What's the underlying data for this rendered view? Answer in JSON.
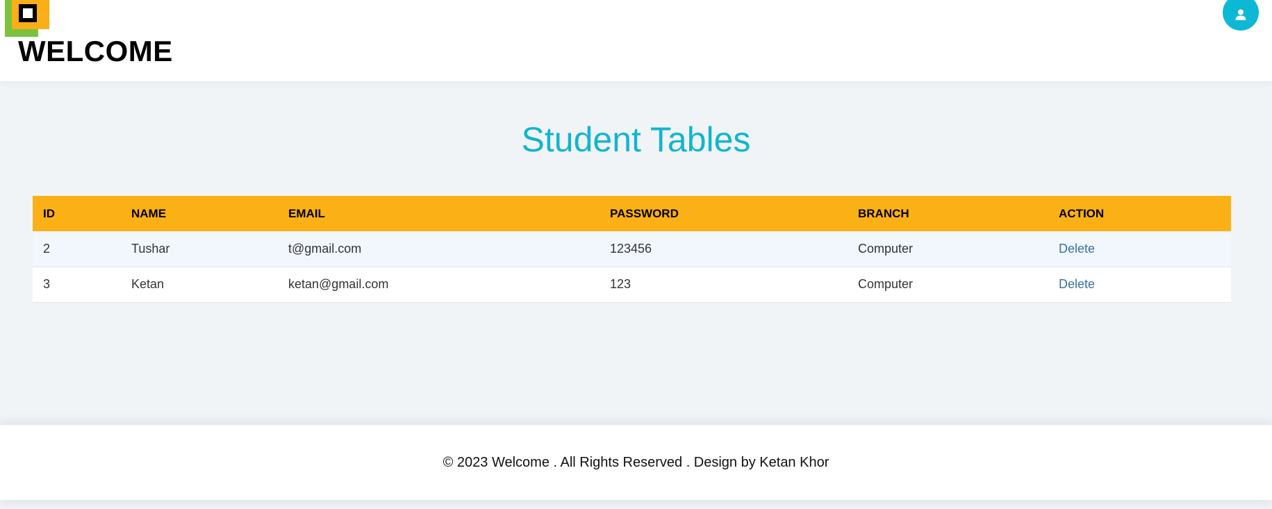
{
  "header": {
    "brand": "WELCOME",
    "logo_colors": [
      "#7cc23f",
      "#fbae17",
      "#000000"
    ],
    "user_icon": "user-icon"
  },
  "main": {
    "title": "Student Tables",
    "table": {
      "columns": [
        "ID",
        "NAME",
        "EMAIL",
        "PASSWORD",
        "BRANCH",
        "ACTION"
      ],
      "rows": [
        {
          "id": "2",
          "name": "Tushar",
          "email": "t@gmail.com",
          "password": "123456",
          "branch": "Computer",
          "action": "Delete"
        },
        {
          "id": "3",
          "name": "Ketan",
          "email": "ketan@gmail.com",
          "password": "123",
          "branch": "Computer",
          "action": "Delete"
        }
      ]
    }
  },
  "footer": {
    "text": "© 2023 Welcome . All Rights Reserved . Design by Ketan Khor"
  },
  "colors": {
    "accent": "#11b5cf",
    "table_header": "#fbb016",
    "link": "#3a6ea5"
  }
}
